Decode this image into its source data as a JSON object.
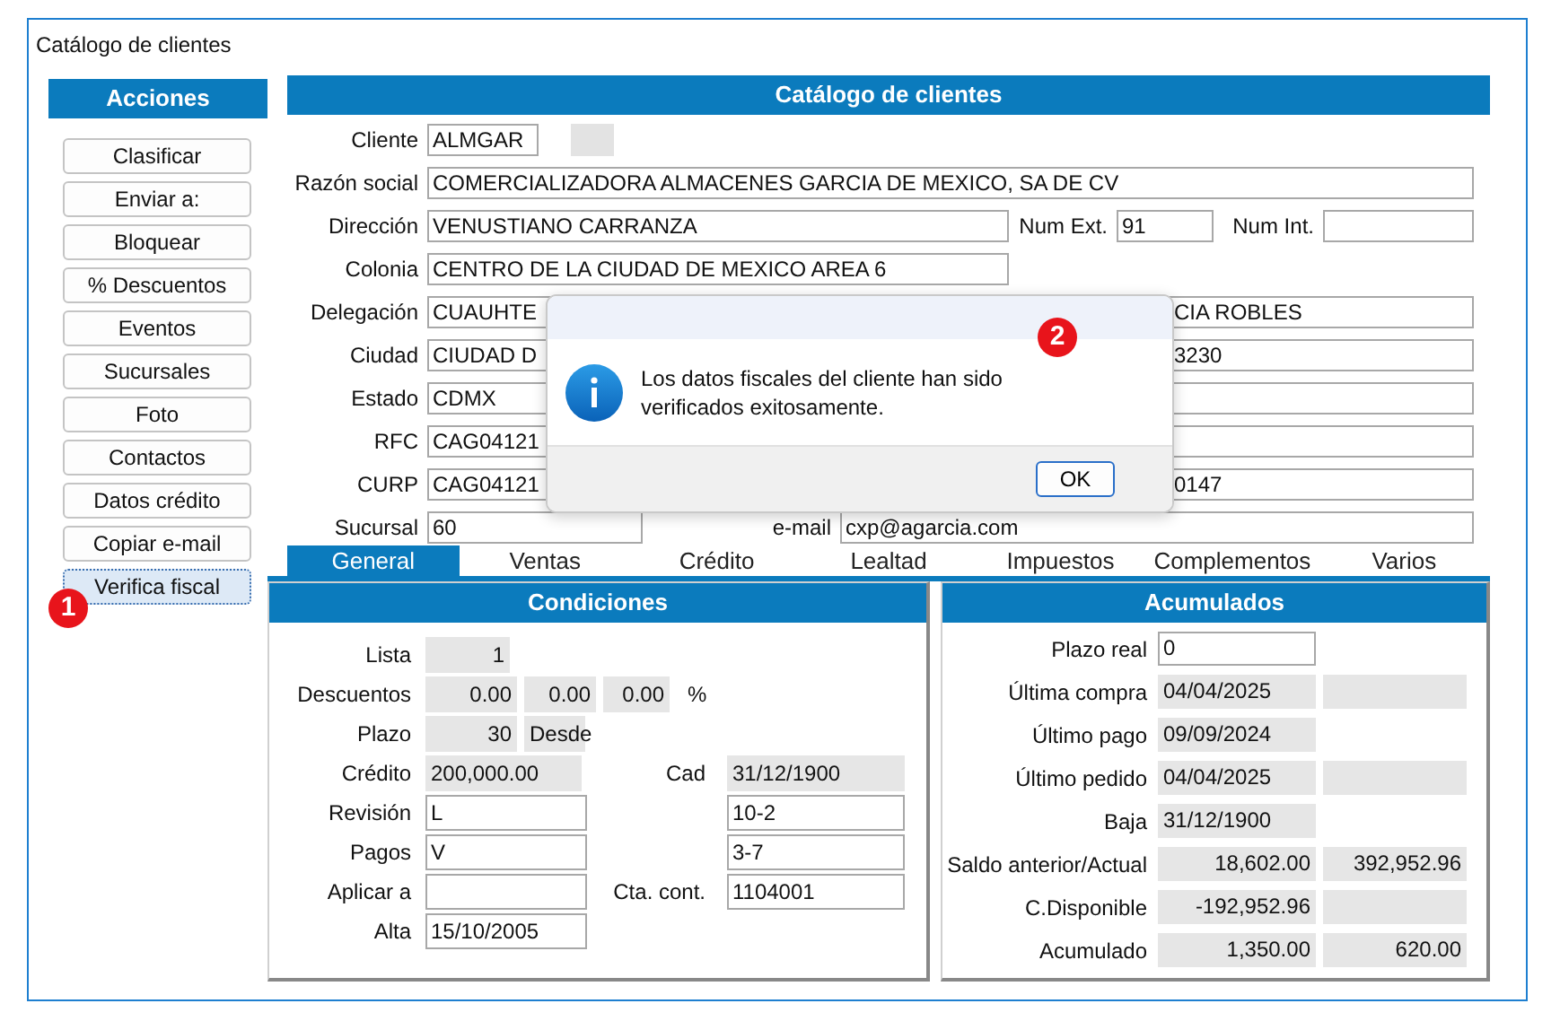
{
  "window": {
    "title": "Catálogo de clientes"
  },
  "actions": {
    "title": "Acciones",
    "buttons": [
      {
        "label": "Clasificar",
        "selected": false
      },
      {
        "label": "Enviar a:",
        "selected": false
      },
      {
        "label": "Bloquear",
        "selected": false
      },
      {
        "label": "%  Descuentos",
        "selected": false
      },
      {
        "label": "Eventos",
        "selected": false
      },
      {
        "label": "Sucursales",
        "selected": false
      },
      {
        "label": "Foto",
        "selected": false
      },
      {
        "label": "Contactos",
        "selected": false
      },
      {
        "label": "Datos crédito",
        "selected": false
      },
      {
        "label": "Copiar e-mail",
        "selected": false
      },
      {
        "label": "Verifica fiscal",
        "selected": true
      }
    ]
  },
  "form": {
    "title": "Catálogo de clientes",
    "rows": [
      {
        "kind": "client",
        "label": "Cliente",
        "value": "ALMGAR"
      },
      {
        "kind": "full",
        "label": "Razón social",
        "value": "COMERCIALIZADORA ALMACENES GARCIA DE MEXICO, SA DE CV"
      },
      {
        "kind": "address",
        "label": "Dirección",
        "value": "VENUSTIANO CARRANZA",
        "ext_label": "Num Ext.",
        "ext_value": "91",
        "int_label": "Num Int."
      },
      {
        "kind": "half",
        "label": "Colonia",
        "value": "CENTRO DE LA CIUDAD DE MEXICO AREA 6"
      },
      {
        "kind": "split",
        "label": "Delegación",
        "value": "CUAUHTE",
        "right_value": "CIA ROBLES"
      },
      {
        "kind": "split",
        "label": "Ciudad",
        "value": "CIUDAD D",
        "right_value": "3230"
      },
      {
        "kind": "split",
        "label": "Estado",
        "value": "CDMX"
      },
      {
        "kind": "split",
        "label": "RFC",
        "value": "CAG04121"
      },
      {
        "kind": "split",
        "label": "CURP",
        "value": "CAG04121",
        "right_value": "0147"
      },
      {
        "kind": "pair",
        "label": "Sucursal",
        "value": "60",
        "second_label": "e-mail",
        "second_value": "cxp@agarcia.com"
      }
    ]
  },
  "tabs": [
    {
      "label": "General",
      "selected": true
    },
    {
      "label": "Ventas",
      "selected": false
    },
    {
      "label": "Crédito",
      "selected": false
    },
    {
      "label": "Lealtad",
      "selected": false
    },
    {
      "label": "Impuestos",
      "selected": false
    },
    {
      "label": "Complementos",
      "selected": false
    },
    {
      "label": "Varios",
      "selected": false
    }
  ],
  "conditions": {
    "title": "Condiciones",
    "rows": [
      {
        "label": "Lista",
        "fields": [
          {
            "kind": "readonly_number",
            "value": "1"
          }
        ]
      },
      {
        "label": "Descuentos",
        "fields": [
          {
            "kind": "readonly_number",
            "value": "0.00"
          },
          {
            "kind": "readonly_number",
            "value": "0.00"
          },
          {
            "kind": "readonly_number",
            "value": "0.00"
          }
        ],
        "unit": "%"
      },
      {
        "label": "Plazo",
        "fields": [
          {
            "kind": "readonly_number",
            "value": "30"
          },
          {
            "kind": "readonly",
            "value": "Desde"
          }
        ]
      },
      {
        "label": "Crédito",
        "fields": [
          {
            "kind": "readonly",
            "value": "200,000.00"
          }
        ],
        "second_label": "Cad",
        "second_fields": [
          {
            "kind": "readonly",
            "value": "31/12/1900"
          }
        ]
      },
      {
        "label": "Revisión",
        "fields": [
          {
            "kind": "input",
            "value": "L"
          }
        ],
        "second_fields": [
          {
            "kind": "input",
            "value": "10-2"
          }
        ]
      },
      {
        "label": "Pagos",
        "fields": [
          {
            "kind": "input",
            "value": "V"
          }
        ],
        "second_fields": [
          {
            "kind": "input",
            "value": "3-7"
          }
        ]
      },
      {
        "label": "Aplicar a",
        "fields": [
          {
            "kind": "input"
          }
        ],
        "second_label": "Cta. cont.",
        "second_fields": [
          {
            "kind": "input",
            "value": "1104001"
          }
        ]
      },
      {
        "label": "Alta",
        "fields": [
          {
            "kind": "input",
            "value": "15/10/2005"
          }
        ]
      }
    ]
  },
  "accumulated": {
    "title": "Acumulados",
    "rows": [
      {
        "label": "Plazo real",
        "fields": [
          {
            "kind": "input",
            "value": "0"
          }
        ]
      },
      {
        "label": "Última compra",
        "fields": [
          {
            "kind": "readonly",
            "value": "04/04/2025"
          },
          {
            "kind": "readonly"
          }
        ]
      },
      {
        "label": "Último pago",
        "fields": [
          {
            "kind": "readonly",
            "value": "09/09/2024"
          }
        ]
      },
      {
        "label": "Último pedido",
        "fields": [
          {
            "kind": "readonly",
            "value": "04/04/2025"
          },
          {
            "kind": "readonly"
          }
        ]
      },
      {
        "label": "Baja",
        "fields": [
          {
            "kind": "readonly",
            "value": "31/12/1900"
          }
        ]
      },
      {
        "label": "Saldo anterior/Actual",
        "fields": [
          {
            "kind": "readonly_number",
            "value": "18,602.00"
          },
          {
            "kind": "readonly_number",
            "value": "392,952.96"
          }
        ]
      },
      {
        "label": "C.Disponible",
        "fields": [
          {
            "kind": "readonly_number",
            "value": "-192,952.96"
          },
          {
            "kind": "readonly"
          }
        ]
      },
      {
        "label": "Acumulado",
        "fields": [
          {
            "kind": "readonly_number",
            "value": "1,350.00"
          },
          {
            "kind": "readonly_number",
            "value": "620.00"
          }
        ]
      }
    ]
  },
  "dialog": {
    "message": "Los datos fiscales del cliente han sido verificados exitosamente.",
    "button": "OK"
  },
  "badges": [
    {
      "text": "1"
    },
    {
      "text": "2"
    }
  ]
}
